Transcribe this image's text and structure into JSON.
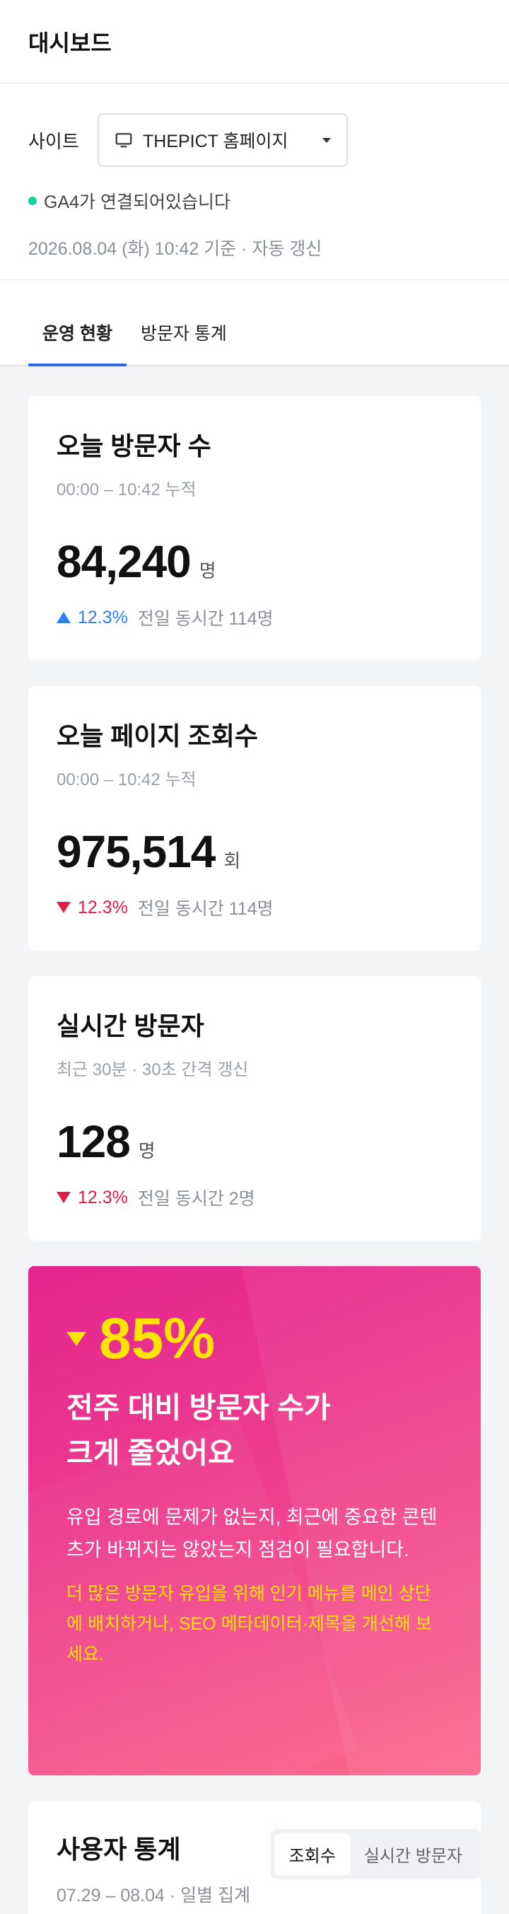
{
  "header": {
    "title": "대시보드"
  },
  "site": {
    "label": "사이트",
    "selected": "THEPICT 홈페이지",
    "ga_status": "GA4가 연결되어있습니다",
    "updated": "2026.08.04 (화) 10:42 기준 · 자동 갱신"
  },
  "tabs": [
    {
      "label": "운영 현황",
      "active": true
    },
    {
      "label": "방문자 통계",
      "active": false
    }
  ],
  "cards": [
    {
      "title": "오늘 방문자 수",
      "sub": "00:00 – 10:42 누적",
      "value": "84,240",
      "unit": "명",
      "direction": "up",
      "pct": "12.3%",
      "compare": "전일 동시간 114명"
    },
    {
      "title": "오늘 페이지 조회수",
      "sub": "00:00 – 10:42 누적",
      "value": "975,514",
      "unit": "회",
      "direction": "down",
      "pct": "12.3%",
      "compare": "전일 동시간 114명"
    },
    {
      "title": "실시간 방문자",
      "sub": "최근 30분 · 30초 간격 갱신",
      "value": "128",
      "unit": "명",
      "direction": "down",
      "pct": "12.3%",
      "compare": "전일 동시간 2명"
    }
  ],
  "promo": {
    "pct": "85%",
    "headline_1": "전주 대비 방문자 수가",
    "headline_2": "크게 줄었어요",
    "desc": "유입 경로에 문제가 없는지, 최근에 중요한 콘텐츠가 바뀌지는 않았는지 점검이 필요합니다.",
    "tip": "더 많은 방문자 유입을 위해 인기 메뉴를 메인 상단에 배치하거나, SEO 메타데이터·제목을 개선해 보세요.",
    "colors": {
      "accent": "#ffe500",
      "gradient_start": "#e4238f",
      "gradient_end": "#fb6a8d"
    }
  },
  "stats": {
    "title": "사용자 통계",
    "sub": "07.29 – 08.04 · 일별 집계",
    "segments": [
      {
        "label": "조회수",
        "active": true
      },
      {
        "label": "실시간 방문자",
        "active": false
      }
    ]
  },
  "icons": {
    "site_select": "monitor-icon",
    "dropdown": "caret-down-icon",
    "up": "triangle-up-icon",
    "down": "triangle-down-icon"
  }
}
